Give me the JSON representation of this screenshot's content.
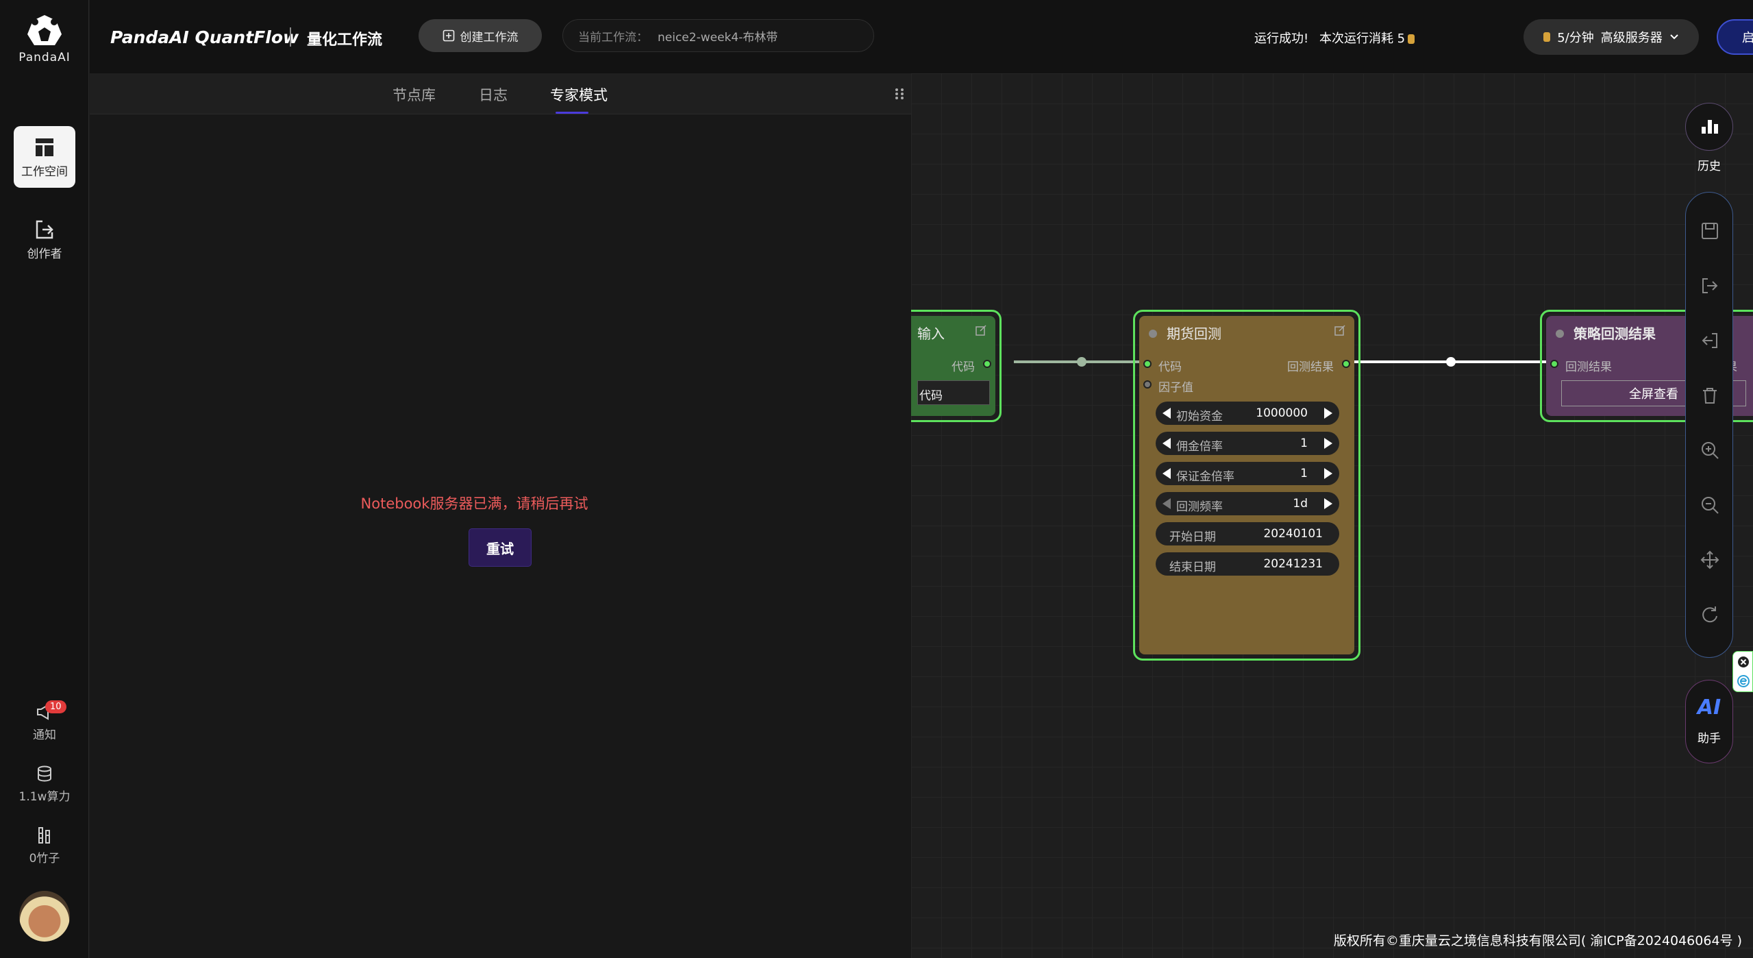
{
  "logo_text": "PandaAI",
  "sidebar": {
    "items": [
      {
        "label": "工作空间",
        "icon": "layout-icon"
      },
      {
        "label": "创作者",
        "icon": "logout-icon"
      }
    ],
    "bottom": [
      {
        "label": "通知",
        "icon": "megaphone-icon",
        "badge": "10"
      },
      {
        "label": "1.1w算力",
        "icon": "database-icon"
      },
      {
        "label": "0竹子",
        "icon": "bamboo-icon"
      }
    ]
  },
  "header": {
    "brand": "PandaAI QuantFlow",
    "subtitle": "量化工作流",
    "create_label": "创建工作流",
    "current_workflow_label": "当前工作流：",
    "current_workflow_value": "neice2-week4-布林带",
    "run_status": "运行成功!",
    "run_cost_label": "本次运行消耗 5",
    "server_rate": "5/分钟",
    "server_name": "高级服务器",
    "start_label": "启动工作流"
  },
  "panel": {
    "tabs": [
      "节点库",
      "日志",
      "专家模式"
    ],
    "active_tab": "专家模式",
    "error_message": "Notebook服务器已满，请稍后再试",
    "retry_label": "重试",
    "collapse_glyph": "‹"
  },
  "nodes": {
    "input": {
      "title": "输入",
      "out_port": "代码",
      "field_value": "代码"
    },
    "futures": {
      "title": "期货回测",
      "in_ports": [
        "代码",
        "因子值"
      ],
      "out_port": "回测结果",
      "fields": [
        {
          "label": "初始资金",
          "value": "1000000"
        },
        {
          "label": "佣金倍率",
          "value": "1"
        },
        {
          "label": "保证金倍率",
          "value": "1"
        },
        {
          "label": "回测频率",
          "value": "1d"
        },
        {
          "label": "开始日期",
          "value": "20240101"
        },
        {
          "label": "结束日期",
          "value": "20241231"
        }
      ]
    },
    "result": {
      "title": "策略回测结果",
      "in_port": "回测结果",
      "out_port_partial": "果",
      "button_label": "全屏查看"
    }
  },
  "right_tools": {
    "history_label": "历史",
    "ai_logo": "AI",
    "ai_label": "助手"
  },
  "footer": "版权所有©重庆量云之境信息科技有限公司( 渝ICP备2024046064号 )",
  "colors": {
    "accent_green": "#5de25d",
    "error_red": "#ec5b5b",
    "start_button": "#16216b",
    "futures_node": "#7a6232",
    "result_node": "#5a3a5e",
    "input_node": "#356d35"
  }
}
